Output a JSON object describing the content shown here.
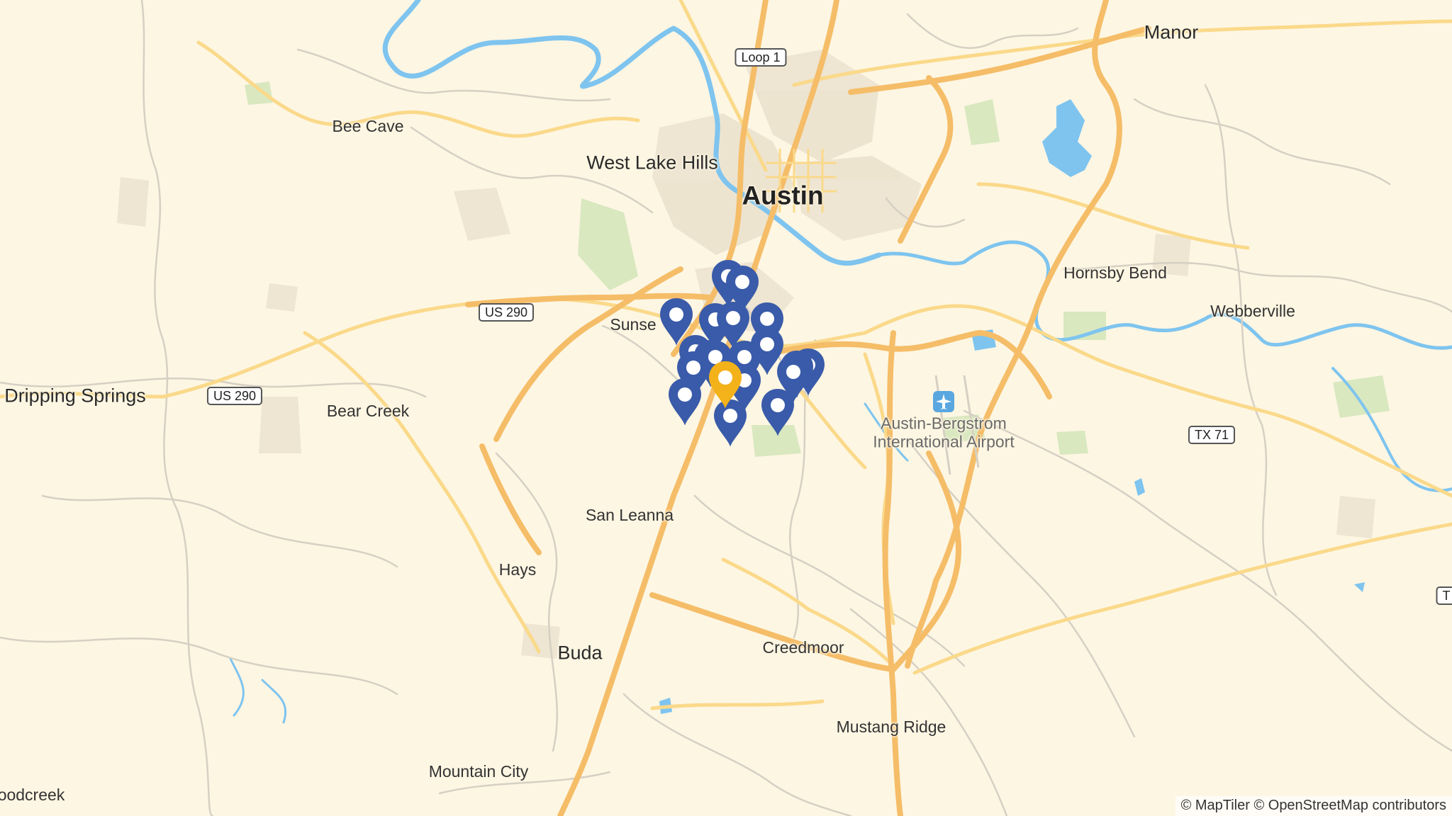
{
  "places": {
    "manor": "Manor",
    "bee_cave": "Bee Cave",
    "west_lake_hills": "West Lake Hills",
    "austin": "Austin",
    "hornsby_bend": "Hornsby Bend",
    "webberville": "Webberville",
    "sunset_valley": "Sunse",
    "dripping_springs": "Dripping Springs",
    "bear_creek": "Bear Creek",
    "airport_line1": "Austin-Bergstrom",
    "airport_line2": "International Airport",
    "san_leanna": "San Leanna",
    "hays": "Hays",
    "buda": "Buda",
    "creedmoor": "Creedmoor",
    "mustang_ridge": "Mustang Ridge",
    "mountain_city": "Mountain City",
    "woodcreek": "oodcreek"
  },
  "road_shields": {
    "loop1": "Loop 1",
    "us290_a": "US 290",
    "us290_b": "US 290",
    "tx71": "TX 71",
    "tx_edge": "T"
  },
  "markers": {
    "default_color": "#3a5ba9",
    "selected_color": "#f3b21a",
    "count_default": 19,
    "count_selected": 1
  },
  "colors": {
    "land": "#fdf6e3",
    "water": "#7ec4ef",
    "park": "#d9e8bf",
    "urban": "#ece3cf",
    "highway": "#f5bd68",
    "major_road": "#fad98a",
    "minor_road": "#d6d0c4"
  },
  "attribution": "© MapTiler © OpenStreetMap contributors"
}
